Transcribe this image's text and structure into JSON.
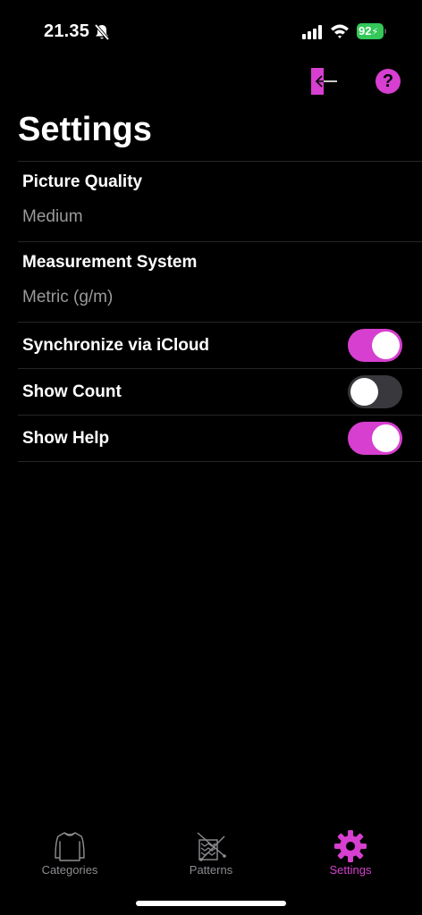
{
  "status_bar": {
    "time": "21.35",
    "battery": "92"
  },
  "nav": {
    "help_label": "?"
  },
  "page": {
    "title": "Settings"
  },
  "settings": {
    "picture_quality": {
      "label": "Picture Quality",
      "value": "Medium"
    },
    "measurement_system": {
      "label": "Measurement System",
      "value": "Metric (g/m)"
    },
    "toggles": [
      {
        "label": "Synchronize via iCloud",
        "on": true
      },
      {
        "label": "Show Count",
        "on": false
      },
      {
        "label": "Show Help",
        "on": true
      }
    ]
  },
  "colors": {
    "accent": "#d63fcf",
    "battery": "#34c759",
    "toggle_off": "#39393d",
    "secondary_text": "#9a9a9a"
  },
  "tabs": [
    {
      "label": "Categories",
      "icon": "sweater-icon",
      "active": false
    },
    {
      "label": "Patterns",
      "icon": "knitting-icon",
      "active": false
    },
    {
      "label": "Settings",
      "icon": "gear-icon",
      "active": true
    }
  ]
}
